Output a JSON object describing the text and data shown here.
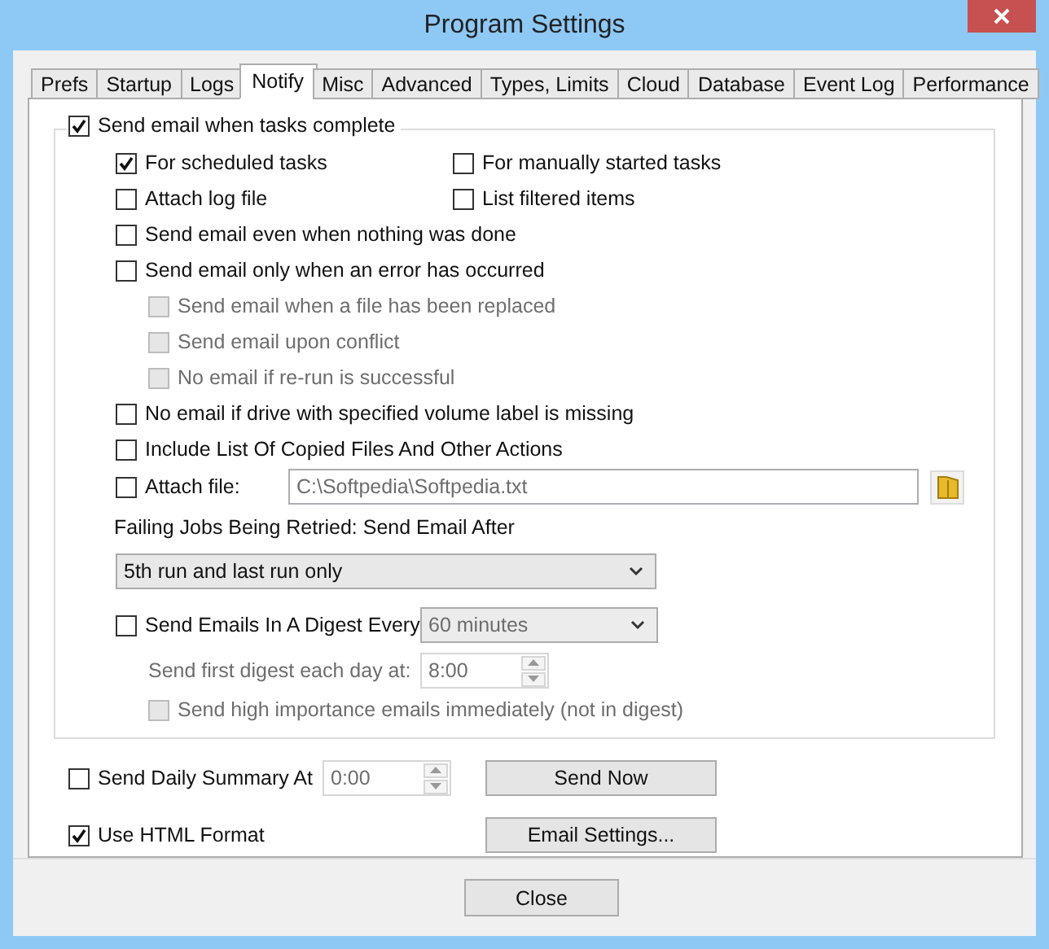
{
  "window": {
    "title": "Program Settings"
  },
  "tabs": [
    {
      "label": "Prefs",
      "selected": false
    },
    {
      "label": "Startup",
      "selected": false
    },
    {
      "label": "Logs",
      "selected": false
    },
    {
      "label": "Notify",
      "selected": true
    },
    {
      "label": "Misc",
      "selected": false
    },
    {
      "label": "Advanced",
      "selected": false
    },
    {
      "label": "Types, Limits",
      "selected": false
    },
    {
      "label": "Cloud",
      "selected": false
    },
    {
      "label": "Database",
      "selected": false
    },
    {
      "label": "Event Log",
      "selected": false
    },
    {
      "label": "Performance",
      "selected": false
    }
  ],
  "group": {
    "label": "Send email when tasks complete",
    "checked": true,
    "rows": [
      {
        "kind": "pair",
        "items": [
          {
            "label": "For scheduled tasks",
            "checked": true
          },
          {
            "label": "For manually started tasks",
            "checked": false
          }
        ]
      },
      {
        "kind": "pair",
        "items": [
          {
            "label": "Attach log file",
            "checked": false
          },
          {
            "label": "List filtered items",
            "checked": false
          }
        ]
      },
      {
        "kind": "check",
        "label": "Send email even when nothing was done",
        "checked": false,
        "disabled": false
      },
      {
        "kind": "check",
        "label": "Send email only when an error has occurred",
        "checked": false,
        "disabled": false,
        "children": [
          {
            "kind": "check",
            "label": "Send email when a file has been replaced",
            "checked": false,
            "disabled": true
          },
          {
            "kind": "check",
            "label": "Send email upon conflict",
            "checked": false,
            "disabled": true
          },
          {
            "kind": "check",
            "label": "No email if re-run is successful",
            "checked": false,
            "disabled": true
          }
        ]
      },
      {
        "kind": "check",
        "label": "No email if drive with specified volume label is missing",
        "checked": false,
        "disabled": false
      },
      {
        "kind": "check",
        "label": "Include List Of Copied Files And Other Actions",
        "checked": false,
        "disabled": false
      },
      {
        "kind": "file",
        "label": "Attach file:",
        "checked": false,
        "value": "C:\\Softpedia\\Softpedia.txt"
      },
      {
        "kind": "heading",
        "label": "Failing Jobs Being Retried: Send Email After"
      },
      {
        "kind": "select",
        "value": "5th run and last run only",
        "disabled": false
      },
      {
        "kind": "digest",
        "label": "Send Emails In A Digest Every",
        "checked": false,
        "select": {
          "value": "60 minutes",
          "disabled": true
        },
        "children": [
          {
            "kind": "time",
            "label": "Send first digest each day at:",
            "value": "8:00",
            "disabled": true
          },
          {
            "kind": "check",
            "label": "Send high importance emails immediately (not in digest)",
            "checked": false,
            "disabled": true
          }
        ]
      }
    ]
  },
  "summary": {
    "label": "Send Daily Summary At",
    "checked": false,
    "time": {
      "value": "0:00",
      "disabled": true
    }
  },
  "html": {
    "label": "Use HTML Format",
    "checked": true
  },
  "buttons": [
    "Send Now",
    "Email Settings..."
  ],
  "close": "Close"
}
